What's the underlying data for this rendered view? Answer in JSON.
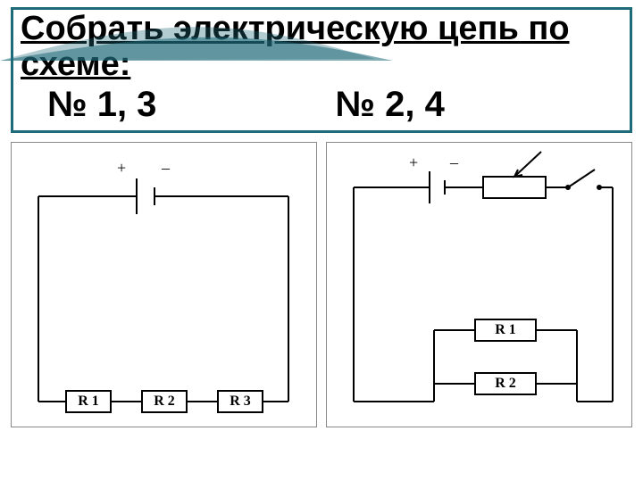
{
  "header": {
    "title": "Собрать электрическую цепь по схеме:",
    "left_label": "№ 1, 3",
    "right_label": "№ 2, 4"
  },
  "circuit_left": {
    "battery": {
      "plus": "+",
      "minus": "–"
    },
    "resistors": [
      "R 1",
      "R 2",
      "R 3"
    ],
    "topology": "series",
    "elements": [
      "battery",
      "R1",
      "R2",
      "R3"
    ]
  },
  "circuit_right": {
    "battery": {
      "plus": "+",
      "minus": "–"
    },
    "has_switch": true,
    "resistors": [
      "R 1",
      "R 2"
    ],
    "topology": "parallel_pair_in_series_with_switch",
    "elements": [
      "battery",
      "switch",
      "R1||R2"
    ]
  },
  "colors": {
    "frame": "#1f6b7a",
    "wire": "#000000"
  }
}
